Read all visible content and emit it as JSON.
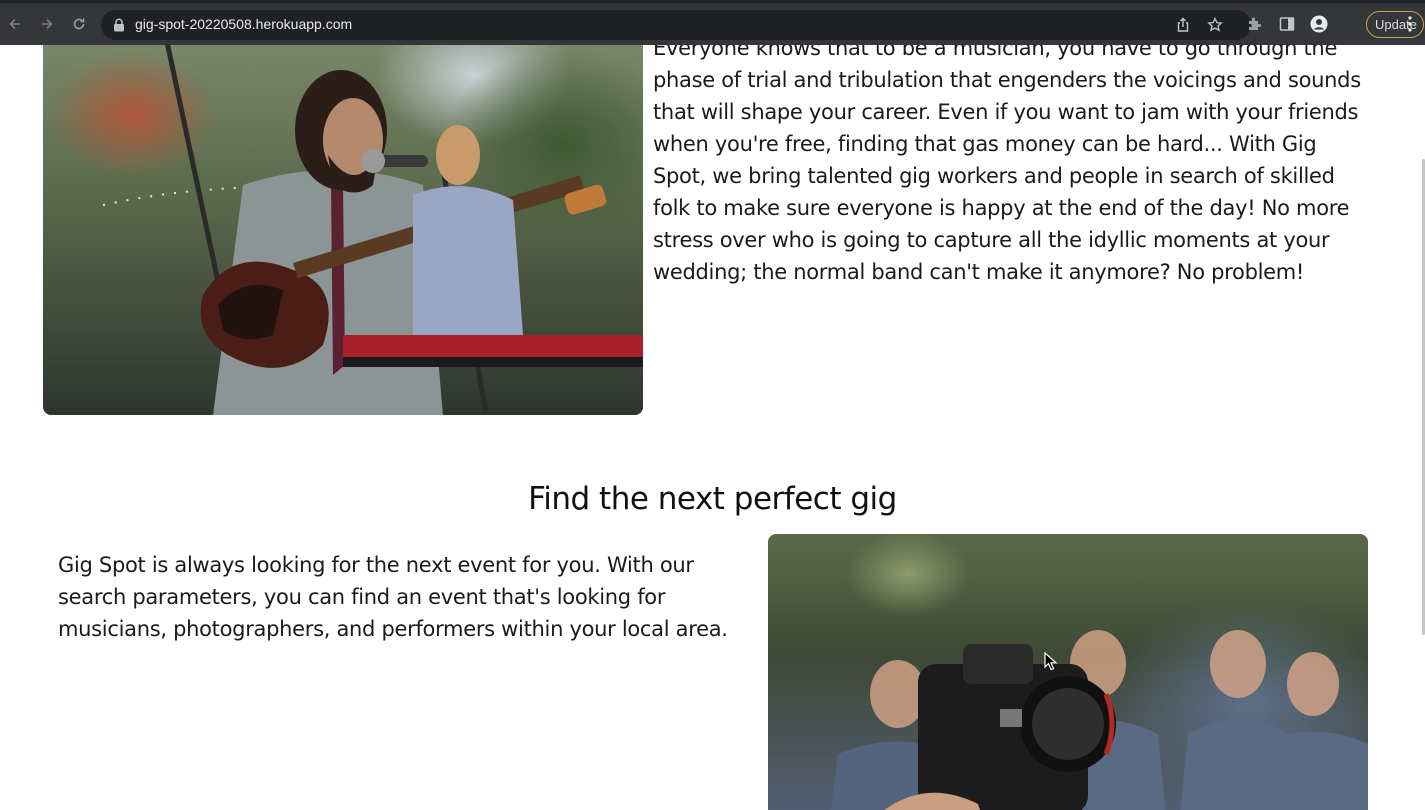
{
  "browser": {
    "url": "gig-spot-20220508.herokuapp.com",
    "update_label": "Update",
    "icons": {
      "back": "back-arrow-icon",
      "forward": "forward-arrow-icon",
      "reload": "reload-icon",
      "lock": "lock-icon",
      "share": "share-icon",
      "bookmark": "star-icon",
      "extensions": "puzzle-icon",
      "side_panel": "side-panel-icon",
      "profile": "profile-icon",
      "menu": "kebab-menu-icon"
    },
    "colors": {
      "toolbar": "#35363a",
      "omnibox": "#202124",
      "update_border": "#c9a54a"
    }
  },
  "page": {
    "intro": {
      "text": "Everyone knows that to be a musician, you have to go through the phase of trial and tribulation that engenders the voicings and sounds that will shape your career. Even if you want to jam with your friends when you're free, finding that gas money can be hard... With Gig Spot, we bring talented gig workers and people in search of skilled folk to make sure everyone is happy at the end of the day! No more stress over who is going to capture all the idyllic moments at your wedding; the normal band can't make it anymore? No problem!"
    },
    "find_gig": {
      "title": "Find the next perfect gig",
      "text": "Gig Spot is always looking for the next event for you. With our search parameters, you can find an event that's looking for musicians, photographers, and performers within your local area."
    }
  }
}
